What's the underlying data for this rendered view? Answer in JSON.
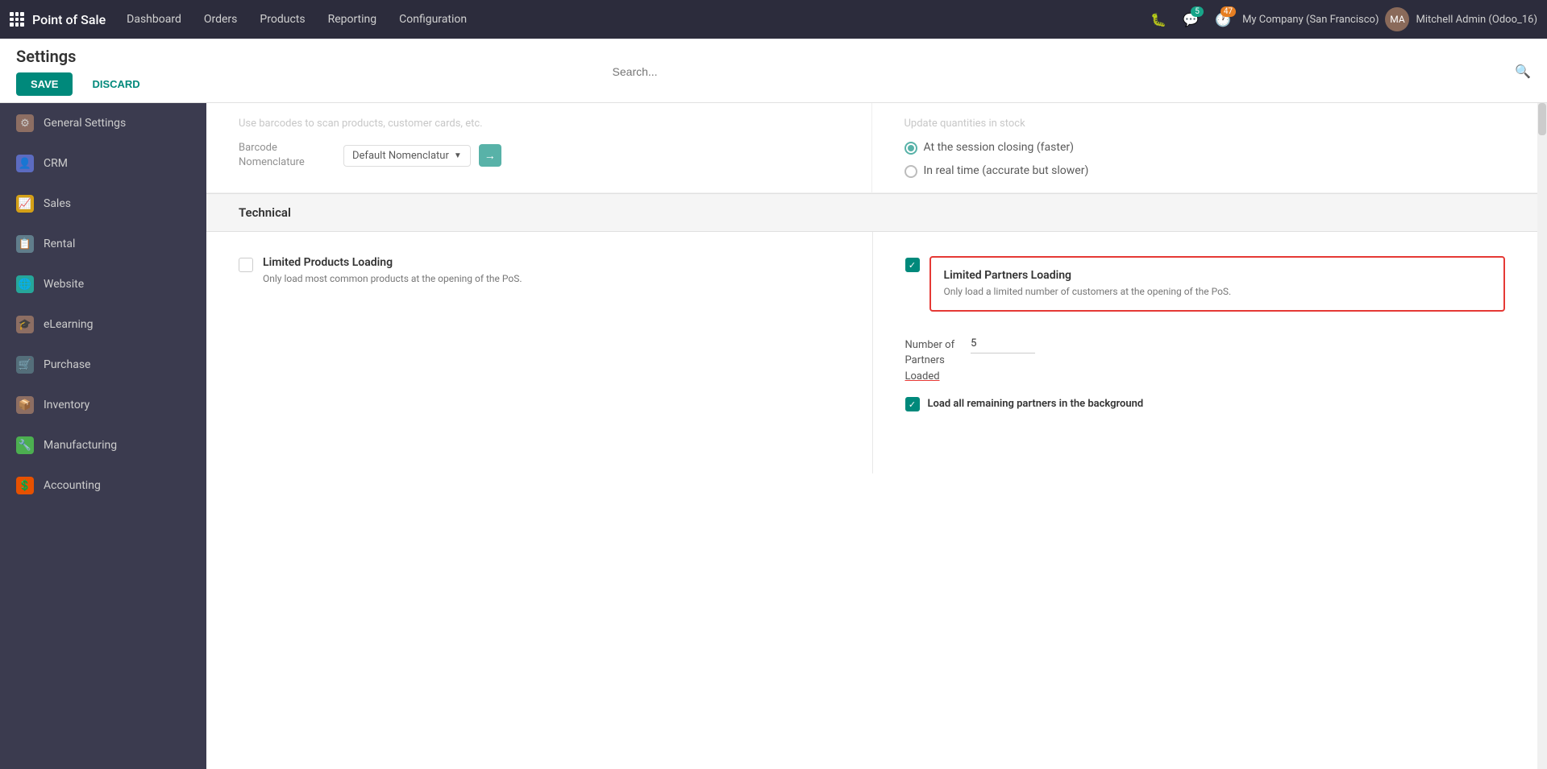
{
  "app": {
    "name": "Point of Sale"
  },
  "navbar": {
    "links": [
      {
        "label": "Dashboard",
        "id": "dashboard"
      },
      {
        "label": "Orders",
        "id": "orders"
      },
      {
        "label": "Products",
        "id": "products"
      },
      {
        "label": "Reporting",
        "id": "reporting"
      },
      {
        "label": "Configuration",
        "id": "configuration"
      }
    ],
    "icons": {
      "bug": "🐛",
      "chat_badge": "5",
      "clock_badge": "47"
    },
    "company": "My Company (San Francisco)",
    "user": "Mitchell Admin (Odoo_16)"
  },
  "settings": {
    "title": "Settings",
    "save_label": "SAVE",
    "discard_label": "DISCARD"
  },
  "search": {
    "placeholder": "Search..."
  },
  "sidebar": {
    "items": [
      {
        "label": "General Settings",
        "icon": "⚙",
        "icon_class": "icon-gear"
      },
      {
        "label": "CRM",
        "icon": "👤",
        "icon_class": "icon-crm"
      },
      {
        "label": "Sales",
        "icon": "📈",
        "icon_class": "icon-sales"
      },
      {
        "label": "Rental",
        "icon": "📋",
        "icon_class": "icon-rental"
      },
      {
        "label": "Website",
        "icon": "🌐",
        "icon_class": "icon-website"
      },
      {
        "label": "eLearning",
        "icon": "🎓",
        "icon_class": "icon-elearning"
      },
      {
        "label": "Purchase",
        "icon": "🛒",
        "icon_class": "icon-purchase"
      },
      {
        "label": "Inventory",
        "icon": "📦",
        "icon_class": "icon-inventory"
      },
      {
        "label": "Manufacturing",
        "icon": "🔧",
        "icon_class": "icon-manufacturing"
      },
      {
        "label": "Accounting",
        "icon": "💲",
        "icon_class": "icon-accounting"
      }
    ]
  },
  "content": {
    "faded_text": "Use barcodes to scan products, customer cards, etc.",
    "faded_text_right": "Update quantities in stock",
    "barcode_label": "Barcode Nomenclature",
    "barcode_value": "Default Nomenclatur",
    "radio_options": [
      {
        "label": "At the session closing (faster)",
        "checked": true
      },
      {
        "label": "In real time (accurate but slower)",
        "checked": false
      }
    ],
    "technical_section": "Technical",
    "limited_products": {
      "title": "Limited Products Loading",
      "desc": "Only load most common products at the opening of the PoS.",
      "checked": false
    },
    "limited_partners": {
      "title": "Limited Partners Loading",
      "desc": "Only load a limited number of customers at the opening of the PoS.",
      "checked": true
    },
    "number_of_partners_label": "Number of Partners Loaded",
    "number_of_partners_value": "5",
    "load_bg_label": "Load all remaining partners in the background",
    "load_bg_checked": true
  }
}
